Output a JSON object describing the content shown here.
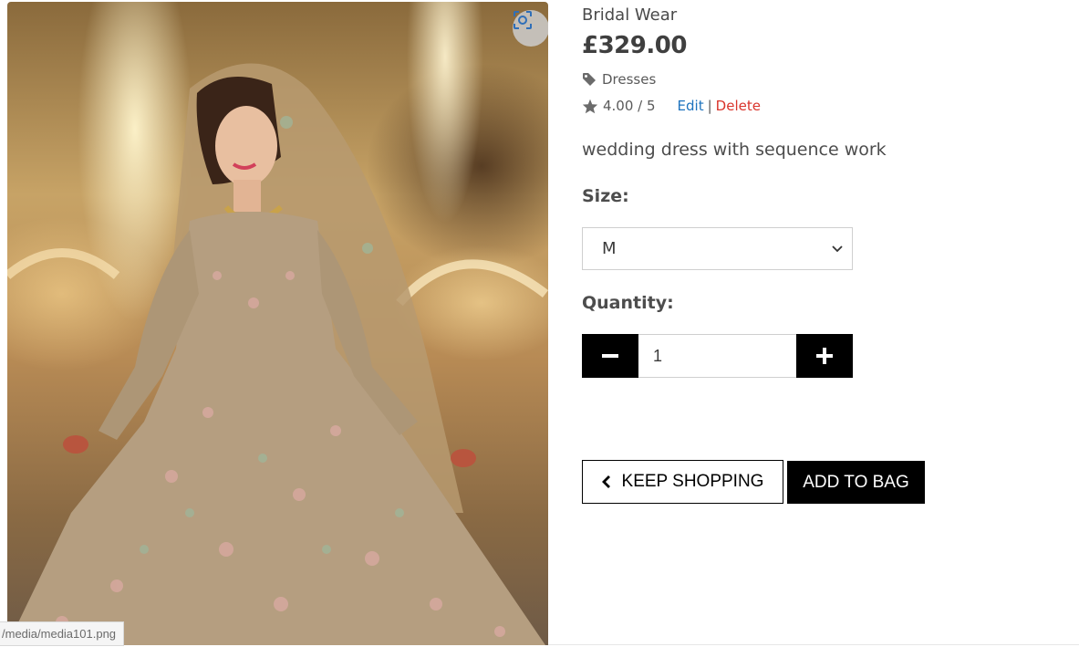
{
  "product": {
    "name": "Bridal Wear",
    "price": "£329.00",
    "category": "Dresses",
    "rating": "4.00 / 5",
    "description": "wedding dress with sequence work",
    "image_alt": "Bride in embroidered bridal gown in front of a fountain"
  },
  "admin_links": {
    "edit_label": "Edit",
    "separator": "|",
    "delete_label": "Delete"
  },
  "size": {
    "label": "Size:",
    "selected": "M"
  },
  "quantity": {
    "label": "Quantity:",
    "value": "1"
  },
  "buttons": {
    "keep_shopping": "KEEP SHOPPING",
    "add_to_bag": "ADD TO BAG"
  },
  "status_bar": {
    "url": "/media/media101.png"
  },
  "icons": {
    "zoom": "zoom-scan-icon",
    "tag": "tag-icon",
    "star": "star-icon",
    "chevron": "chevron-down-icon",
    "minus": "minus-icon",
    "plus": "plus-icon",
    "back": "chevron-left-icon"
  },
  "colors": {
    "edit_link": "#1e73be",
    "delete_link": "#d9342b",
    "button_dark": "#000000"
  }
}
